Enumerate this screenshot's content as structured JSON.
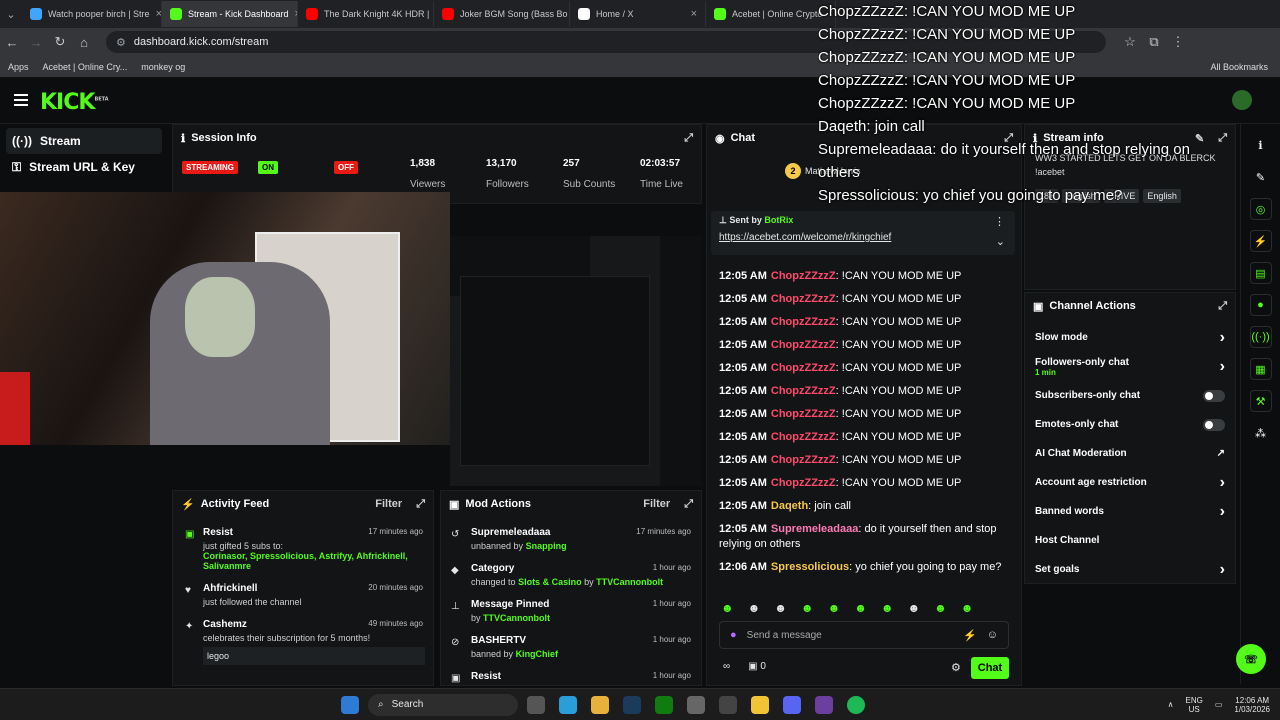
{
  "browser": {
    "tabs": [
      {
        "label": "Watch pooper birch | Stre",
        "color": "#3ea6ff"
      },
      {
        "label": "Stream - Kick Dashboard",
        "color": "#53fc18",
        "active": true
      },
      {
        "label": "The Dark Knight 4K HDR |",
        "color": "#ff0000"
      },
      {
        "label": "Joker BGM Song (Bass Bo",
        "color": "#ff0000"
      },
      {
        "label": "Home / X",
        "color": "#ffffff"
      },
      {
        "label": "Acebet | Online Crypto",
        "color": "#53fc18"
      }
    ],
    "url": "dashboard.kick.com/stream",
    "bookmarks": [
      "Apps",
      "Acebet | Online Cry...",
      "monkey og",
      "All Bookmarks"
    ]
  },
  "sidebar": {
    "items": [
      {
        "label": "Stream",
        "icon": "stream-icon"
      },
      {
        "label": "Stream URL & Key",
        "icon": "key-icon"
      }
    ]
  },
  "session": {
    "title": "Session Info",
    "status": "STREAMING",
    "on": "ON",
    "off": "OFF",
    "stats": [
      {
        "value": "1,838",
        "label": "Viewers"
      },
      {
        "value": "13,170",
        "label": "Followers"
      },
      {
        "value": "257",
        "label": "Sub Counts"
      },
      {
        "value": "02:03:57",
        "label": "Time Live"
      }
    ]
  },
  "chat": {
    "title": "Chat",
    "pinned_label": "Sent by",
    "pinned_sender": "BotRix",
    "pinned_link": "https://acebet.com/welcome/r/kingchief",
    "gift_user": "MathewHarris",
    "gift_count": "2",
    "messages": [
      {
        "time": "12:05 AM",
        "user": "ChopzZZzzZ",
        "text": "!CAN YOU MOD ME UP",
        "cls": "name-red"
      },
      {
        "time": "12:05 AM",
        "user": "ChopzZZzzZ",
        "text": "!CAN YOU MOD ME UP",
        "cls": "name-red"
      },
      {
        "time": "12:05 AM",
        "user": "ChopzZZzzZ",
        "text": "!CAN YOU MOD ME UP",
        "cls": "name-red"
      },
      {
        "time": "12:05 AM",
        "user": "ChopzZZzzZ",
        "text": "!CAN YOU MOD ME UP",
        "cls": "name-red"
      },
      {
        "time": "12:05 AM",
        "user": "ChopzZZzzZ",
        "text": "!CAN YOU MOD ME UP",
        "cls": "name-red"
      },
      {
        "time": "12:05 AM",
        "user": "ChopzZZzzZ",
        "text": "!CAN YOU MOD ME UP",
        "cls": "name-red"
      },
      {
        "time": "12:05 AM",
        "user": "ChopzZZzzZ",
        "text": "!CAN YOU MOD ME UP",
        "cls": "name-red"
      },
      {
        "time": "12:05 AM",
        "user": "ChopzZZzzZ",
        "text": "!CAN YOU MOD ME UP",
        "cls": "name-red"
      },
      {
        "time": "12:05 AM",
        "user": "ChopzZZzzZ",
        "text": "!CAN YOU MOD ME UP",
        "cls": "name-red"
      },
      {
        "time": "12:05 AM",
        "user": "ChopzZZzzZ",
        "text": "!CAN YOU MOD ME UP",
        "cls": "name-red"
      },
      {
        "time": "12:05 AM",
        "user": "Daqeth",
        "text": "join call",
        "cls": "name-yel"
      },
      {
        "time": "12:05 AM",
        "user": "Supremeleadaaa",
        "text": "do it yourself then and stop relying on others",
        "cls": "name-pink"
      },
      {
        "time": "12:06 AM",
        "user": "Spressolicious",
        "text": "yo chief you going to pay me?",
        "cls": "name-yel"
      }
    ],
    "input_placeholder": "Send a message",
    "send_label": "Chat",
    "points": "0"
  },
  "stream_info": {
    "title": "Stream info",
    "stream_title": "WW3 STARTED LETS GET ON DA BLERCK",
    "command": "!acebet",
    "tags": [
      "18+",
      "English",
      "CHIVE",
      "English"
    ]
  },
  "channel_actions": {
    "title": "Channel Actions",
    "items": [
      {
        "label": "Slow mode",
        "control": "chevron"
      },
      {
        "label": "Followers-only chat",
        "sub": "1 min",
        "control": "chevron"
      },
      {
        "label": "Subscribers-only chat",
        "control": "toggle"
      },
      {
        "label": "Emotes-only chat",
        "control": "toggle"
      },
      {
        "label": "AI Chat Moderation",
        "control": "external"
      },
      {
        "label": "Account age restriction",
        "control": "chevron"
      },
      {
        "label": "Banned words",
        "control": "chevron"
      },
      {
        "label": "Host Channel",
        "control": "none"
      },
      {
        "label": "Set goals",
        "control": "chevron"
      }
    ]
  },
  "activity": {
    "title": "Activity Feed",
    "filter": "Filter",
    "items": [
      {
        "name": "Resist",
        "text": "just gifted 5 subs to:",
        "extra": "Corinasor, Spressolicious, Astrifyy, Ahfrickinell, Salivanmre",
        "ago": "17 minutes ago"
      },
      {
        "name": "Ahfrickinell",
        "text": "just followed the channel",
        "ago": "20 minutes ago"
      },
      {
        "name": "Cashemz",
        "text": "celebrates their subscription for 5 months!",
        "extra": "legoo",
        "ago": "49 minutes ago"
      }
    ]
  },
  "mod_actions": {
    "title": "Mod Actions",
    "filter": "Filter",
    "items": [
      {
        "name": "Supremeleadaaa",
        "text": "unbanned by",
        "by": "Snapping",
        "ago": "17 minutes ago"
      },
      {
        "name": "Category",
        "text": "changed to",
        "by": "Slots & Casino",
        "by2": "TTVCannonbolt",
        "ago": "1 hour ago"
      },
      {
        "name": "Message Pinned",
        "text": "by",
        "by": "TTVCannonbolt",
        "ago": "1 hour ago"
      },
      {
        "name": "BASHERTV",
        "text": "banned by",
        "by": "KingChief",
        "ago": "1 hour ago"
      },
      {
        "name": "Resist",
        "text": "",
        "by": "",
        "ago": "1 hour ago"
      }
    ]
  },
  "overlay": {
    "lines": [
      "ChopzZZzzZ: !CAN YOU MOD ME UP",
      "ChopzZZzzZ: !CAN YOU MOD ME UP",
      "ChopzZZzzZ: !CAN YOU MOD ME UP",
      "ChopzZZzzZ: !CAN YOU MOD ME UP",
      "ChopzZZzzZ: !CAN YOU MOD ME UP",
      "Daqeth: join call",
      "Supremeleadaaa: do it yourself then and stop relying on others",
      "Spressolicious: yo chief you going to pay me?"
    ]
  },
  "taskbar": {
    "search": "Search",
    "lang": "ENG",
    "region": "US",
    "time": "12:06 AM",
    "date": "1/03/2026"
  },
  "colors": {
    "accent": "#53fc18",
    "bg": "#0b0d0e",
    "panel": "#121416",
    "red": "#e91916"
  }
}
